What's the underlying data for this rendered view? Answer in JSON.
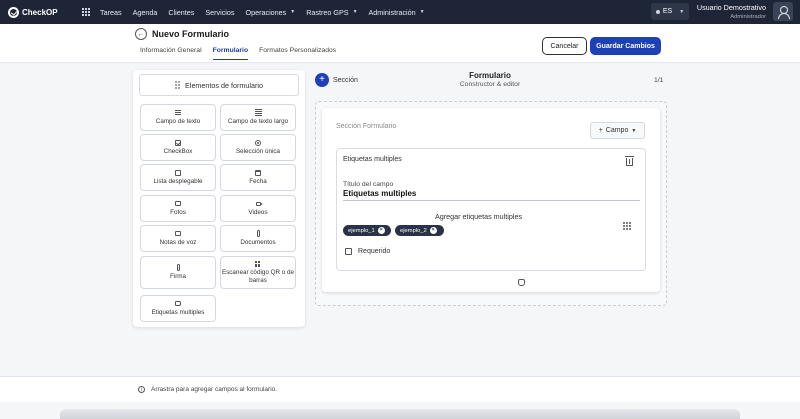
{
  "topnav": {
    "logo_text": "CheckOP",
    "menu": [
      {
        "label": "Tareas",
        "has_caret": false
      },
      {
        "label": "Agenda",
        "has_caret": false
      },
      {
        "label": "Clientes",
        "has_caret": false
      },
      {
        "label": "Servicios",
        "has_caret": false
      },
      {
        "label": "Operaciones",
        "has_caret": true
      },
      {
        "label": "Rastreo GPS",
        "has_caret": true
      },
      {
        "label": "Administración",
        "has_caret": true
      }
    ],
    "language": "ES",
    "user_name": "Usuario Demostrativo",
    "user_role": "Administrador"
  },
  "header": {
    "title": "Nuevo Formulario",
    "tabs": [
      "Información General",
      "Formulario",
      "Formatos Personalizados"
    ],
    "active_tab": "Formulario",
    "cancel_label": "Cancelar",
    "save_label": "Guardar Cambios"
  },
  "palette": {
    "title": "Elementos de formulario",
    "items": [
      {
        "label": "Campo de texto",
        "icon": "text-lines-icon"
      },
      {
        "label": "Campo de texto largo",
        "icon": "long-text-icon"
      },
      {
        "label": "CheckBox",
        "icon": "checkbox-icon"
      },
      {
        "label": "Selección única",
        "icon": "radio-icon"
      },
      {
        "label": "Lista desplegable",
        "icon": "list-icon"
      },
      {
        "label": "Fecha",
        "icon": "calendar-icon"
      },
      {
        "label": "Fotos",
        "icon": "image-icon"
      },
      {
        "label": "Videos",
        "icon": "video-icon"
      },
      {
        "label": "Notas de voz",
        "icon": "image-icon"
      },
      {
        "label": "Documentos",
        "icon": "paperclip-icon"
      },
      {
        "label": "Firma",
        "icon": "paperclip-icon"
      },
      {
        "label": "Escanear código QR o de barras",
        "icon": "qr-icon"
      },
      {
        "label": "Etiquetas multiples",
        "icon": "tag-icon"
      }
    ]
  },
  "builder": {
    "add_section_label": "Sección",
    "title": "Formulario",
    "subtitle": "Constructor & editor",
    "pager": "1/1",
    "section_label": "Sección Formulario",
    "add_field_label": "Campo",
    "field": {
      "type_label": "Etiquetas multiples",
      "title_label": "Título del campo",
      "title_value": "Etiquetas multiples",
      "multi_label": "Agregar etiquetas multiples",
      "chips": [
        "ejemplo_1",
        "ejemplo_2"
      ],
      "required_label": "Requerido",
      "required_checked": false
    }
  },
  "footer": {
    "hint": "Arrastra para agregar campos al formulario."
  },
  "colors": {
    "nav_bg": "#1e2537",
    "primary": "#1d3fb8",
    "chip_bg": "#293246"
  }
}
